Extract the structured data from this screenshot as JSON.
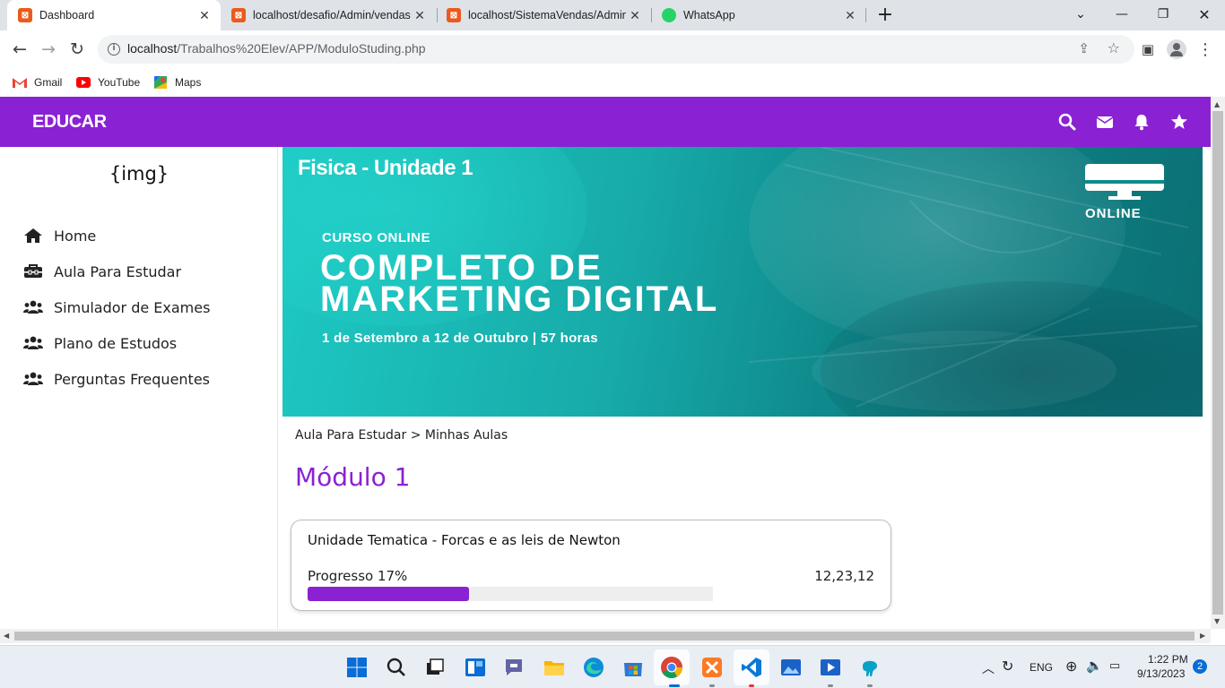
{
  "browser": {
    "tabs": [
      {
        "title": "Dashboard",
        "active": true,
        "favicon": "xampp-icon"
      },
      {
        "title": "localhost/desafio/Admin/vendas",
        "active": false,
        "favicon": "xampp-icon"
      },
      {
        "title": "localhost/SistemaVendas/Admin/",
        "active": false,
        "favicon": "xampp-icon"
      },
      {
        "title": "WhatsApp",
        "active": false,
        "favicon": "whatsapp-icon"
      }
    ],
    "new_tab_label": "+",
    "url_host": "localhost",
    "url_path": "/Trabalhos%20Elev/APP/ModuloStuding.php",
    "bookmarks": [
      {
        "label": "Gmail",
        "icon": "gmail-icon"
      },
      {
        "label": "YouTube",
        "icon": "youtube-icon"
      },
      {
        "label": "Maps",
        "icon": "maps-icon"
      }
    ]
  },
  "navbar": {
    "brand": "EDUCAR",
    "icons": [
      "search-icon",
      "envelope-icon",
      "bell-icon",
      "star-icon"
    ],
    "color": "#8a21d3"
  },
  "sidebar": {
    "logo_placeholder": "{img}",
    "items": [
      {
        "label": "Home",
        "icon": "home-icon"
      },
      {
        "label": "Aula Para Estudar",
        "icon": "toolbox-icon"
      },
      {
        "label": "Simulador de Exames",
        "icon": "users-icon"
      },
      {
        "label": "Plano de Estudos",
        "icon": "users-icon"
      },
      {
        "label": "Perguntas Frequentes",
        "icon": "users-icon"
      }
    ]
  },
  "banner": {
    "title": "Fisica - Unidade 1",
    "subtitle": "CURSO ONLINE",
    "headline_line1": "COMPLETO DE",
    "headline_line2": "MARKETING DIGITAL",
    "dates": "1 de Setembro a 12 de Outubro | 57 horas",
    "badge_label": "ONLINE"
  },
  "breadcrumb": "Aula Para Estudar > Minhas Aulas",
  "module": {
    "title": "Módulo 1",
    "unit": {
      "title": "Unidade Tematica - Forcas e as leis de Newton",
      "progress_label": "Progresso 17%",
      "progress_value": 0.17,
      "code": "12,23,12"
    }
  },
  "taskbar": {
    "lang": "ENG",
    "time": "1:22 PM",
    "date": "9/13/2023",
    "notifications": "2"
  }
}
